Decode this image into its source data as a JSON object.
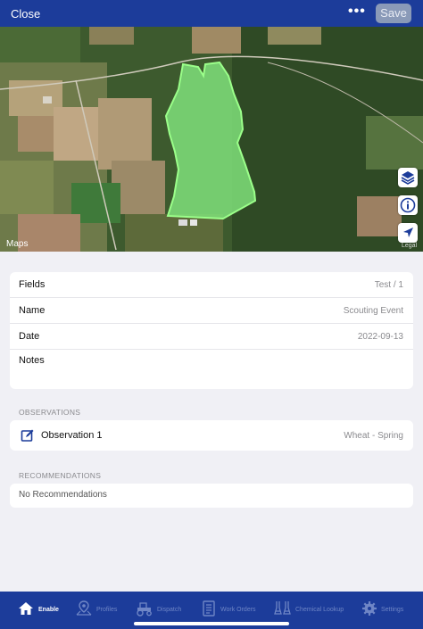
{
  "topbar": {
    "close_label": "Close",
    "more_label": "•••",
    "save_label": "Save"
  },
  "map": {
    "attribution": "Maps",
    "legal": "Legal"
  },
  "details": {
    "rows": [
      {
        "label": "Fields",
        "value": "Test / 1"
      },
      {
        "label": "Name",
        "value": "Scouting Event"
      },
      {
        "label": "Date",
        "value": "2022-09-13"
      },
      {
        "label": "Notes",
        "value": ""
      }
    ]
  },
  "observations": {
    "header": "OBSERVATIONS",
    "items": [
      {
        "title": "Observation 1",
        "value": "Wheat - Spring",
        "icon": "edit-icon"
      }
    ]
  },
  "recommendations": {
    "header": "RECOMMENDATIONS",
    "empty_text": "No Recommendations"
  },
  "tabbar": {
    "tabs": [
      {
        "label": "Enable",
        "icon": "home-icon",
        "active": true
      },
      {
        "label": "Profiles",
        "icon": "map-pin-icon",
        "active": false
      },
      {
        "label": "Dispatch",
        "icon": "tractor-icon",
        "active": false
      },
      {
        "label": "Work Orders",
        "icon": "document-icon",
        "active": false
      },
      {
        "label": "Chemical Lookup",
        "icon": "flask-icon",
        "active": false
      },
      {
        "label": "Settings",
        "icon": "gear-icon",
        "active": false
      }
    ]
  },
  "colors": {
    "brand": "#1c3c9a",
    "field_fill": "#7fe07a",
    "field_stroke": "#9bff8a",
    "inactive_tab": "#6f86c6"
  }
}
